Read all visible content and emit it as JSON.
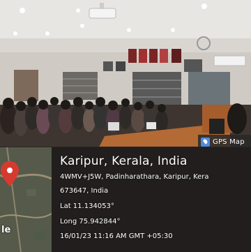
{
  "badge": {
    "label": "GPS Map",
    "icon": "gps-map-icon"
  },
  "map": {
    "logo_fragment": "le",
    "pin_color": "#d63a2f"
  },
  "location": {
    "place": "Karipur, Kerala, India",
    "address_line1": "4WMV+J5W, Padinharathara, Karipur, Kera",
    "address_line2": "673647, India",
    "latitude": "Lat 11.134053°",
    "longitude": "Long 75.942844°",
    "timestamp": "16/01/23 11:16 AM GMT +05:30"
  }
}
